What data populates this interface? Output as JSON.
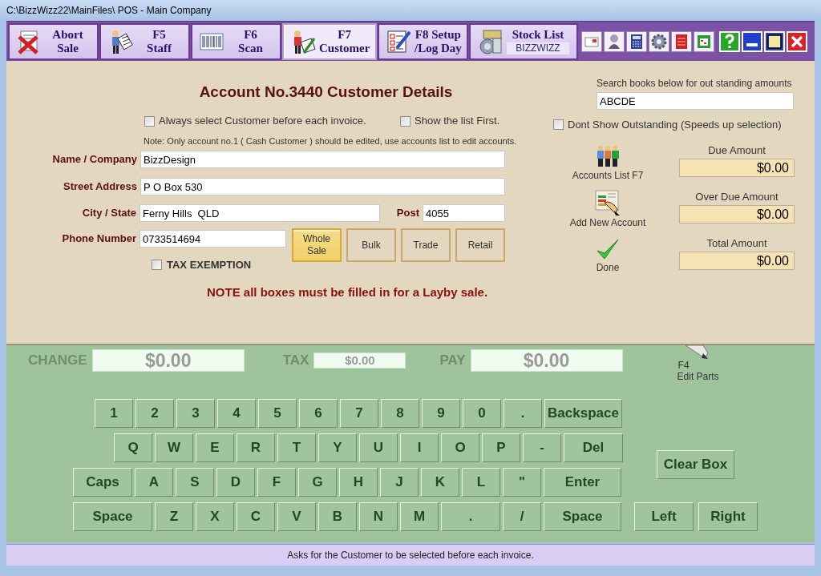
{
  "window": {
    "title": "C:\\BizzWizz22\\MainFiles\\ POS - Main Company"
  },
  "toolbar": {
    "buttons": [
      {
        "kind": "abort",
        "lines": [
          "Abort",
          "Sale"
        ],
        "selected": false
      },
      {
        "kind": "staff",
        "lines": [
          "F5",
          "Staff"
        ],
        "selected": false
      },
      {
        "kind": "scan",
        "lines": [
          "F6",
          "Scan"
        ],
        "selected": false
      },
      {
        "kind": "customer",
        "lines": [
          "F7",
          "Customer"
        ],
        "selected": true
      },
      {
        "kind": "setup",
        "lines": [
          "F8 Setup",
          "/Log Day"
        ],
        "selected": false
      },
      {
        "kind": "stock",
        "lines": [
          "Stock List"
        ],
        "sublabel": "BIZZWIZZ",
        "selected": false
      }
    ]
  },
  "customer_form": {
    "heading": "Account No.3440 Customer Details",
    "options": [
      {
        "label": "Always select Customer before each invoice.",
        "checked": false
      },
      {
        "label": "Show the list First.",
        "checked": false
      }
    ],
    "note": "Note: Only account no.1 ( Cash Customer ) should be edited, use accounts list to edit accounts.",
    "fields": [
      {
        "label": "Name / Company",
        "value": "BizzDesign"
      },
      {
        "label": "Street  Address",
        "value": "P O Box 530"
      },
      {
        "label": "City / State",
        "value": "Ferny Hills  QLD"
      },
      {
        "label": "Post",
        "value": "4055"
      },
      {
        "label": "Phone Number",
        "value": "0733514694"
      }
    ],
    "price_levels": [
      {
        "label": "Whole Sale",
        "selected": true
      },
      {
        "label": "Bulk",
        "selected": false
      },
      {
        "label": "Trade",
        "selected": false
      },
      {
        "label": "Retail",
        "selected": false
      }
    ],
    "tax_exemption": {
      "label": "TAX EXEMPTION",
      "checked": false
    },
    "layby_note": "NOTE all boxes must be filled in for a Layby sale."
  },
  "side_panel": {
    "search_label": "Search books below for out standing amounts",
    "search_value": "ABCDE",
    "dont_show": {
      "label": "Dont Show Outstanding (Speeds up selection)",
      "checked": false
    },
    "actions": [
      {
        "kind": "accounts",
        "label": "Accounts List F7"
      },
      {
        "kind": "add",
        "label": "Add New Account"
      },
      {
        "kind": "done",
        "label": "Done"
      }
    ],
    "amounts": [
      {
        "label": "Due Amount",
        "value": "$0.00"
      },
      {
        "label": "Over Due Amount",
        "value": "$0.00"
      },
      {
        "label": "Total Amount",
        "value": "$0.00"
      }
    ]
  },
  "totals": [
    {
      "label": "CHANGE",
      "value": "$0.00",
      "kind": "large"
    },
    {
      "label": "TAX",
      "value": "$0.00",
      "kind": "small"
    },
    {
      "label": "PAY",
      "value": "$0.00",
      "kind": "large"
    }
  ],
  "edit_parts": {
    "key": "F4",
    "label": "Edit Parts"
  },
  "keyboard": {
    "number_row": [
      {
        "label": "1",
        "kind": "key"
      },
      {
        "label": "2",
        "kind": "key"
      },
      {
        "label": "3",
        "kind": "key"
      },
      {
        "label": "4",
        "kind": "key"
      },
      {
        "label": "5",
        "kind": "key"
      },
      {
        "label": "6",
        "kind": "key"
      },
      {
        "label": "7",
        "kind": "key"
      },
      {
        "label": "8",
        "kind": "key"
      },
      {
        "label": "9",
        "kind": "key"
      },
      {
        "label": "0",
        "kind": "key"
      },
      {
        "label": ".",
        "kind": "key"
      },
      {
        "label": "Backspace",
        "kind": "wide"
      }
    ],
    "top_row": [
      {
        "label": "Q",
        "kind": "key"
      },
      {
        "label": "W",
        "kind": "key"
      },
      {
        "label": "E",
        "kind": "key"
      },
      {
        "label": "R",
        "kind": "key"
      },
      {
        "label": "T",
        "kind": "key"
      },
      {
        "label": "Y",
        "kind": "key"
      },
      {
        "label": "U",
        "kind": "key"
      },
      {
        "label": "I",
        "kind": "key"
      },
      {
        "label": "O",
        "kind": "key"
      },
      {
        "label": "P",
        "kind": "key"
      },
      {
        "label": "-",
        "kind": "key"
      },
      {
        "label": "Del",
        "kind": "medium"
      }
    ],
    "home_row": [
      {
        "label": "Caps",
        "kind": "medium"
      },
      {
        "label": "A",
        "kind": "key"
      },
      {
        "label": "S",
        "kind": "key"
      },
      {
        "label": "D",
        "kind": "key"
      },
      {
        "label": "F",
        "kind": "key"
      },
      {
        "label": "G",
        "kind": "key"
      },
      {
        "label": "H",
        "kind": "key"
      },
      {
        "label": "J",
        "kind": "key"
      },
      {
        "label": "K",
        "kind": "key"
      },
      {
        "label": "L",
        "kind": "key"
      },
      {
        "label": "\"",
        "kind": "key"
      },
      {
        "label": "Enter",
        "kind": "wide"
      }
    ],
    "bottom_row": [
      {
        "label": "Space",
        "kind": "space"
      },
      {
        "label": "Z",
        "kind": "key"
      },
      {
        "label": "X",
        "kind": "key"
      },
      {
        "label": "C",
        "kind": "key"
      },
      {
        "label": "V",
        "kind": "key"
      },
      {
        "label": "B",
        "kind": "key"
      },
      {
        "label": "N",
        "kind": "key"
      },
      {
        "label": "M",
        "kind": "key"
      },
      {
        "label": ".",
        "kind": "medium"
      },
      {
        "label": "/",
        "kind": "key"
      },
      {
        "label": "Space",
        "kind": "wide"
      }
    ],
    "clear": "Clear Box",
    "arrows": [
      "Left",
      "Right"
    ]
  },
  "status_bar": "Asks for the Customer to be selected before each invoice."
}
